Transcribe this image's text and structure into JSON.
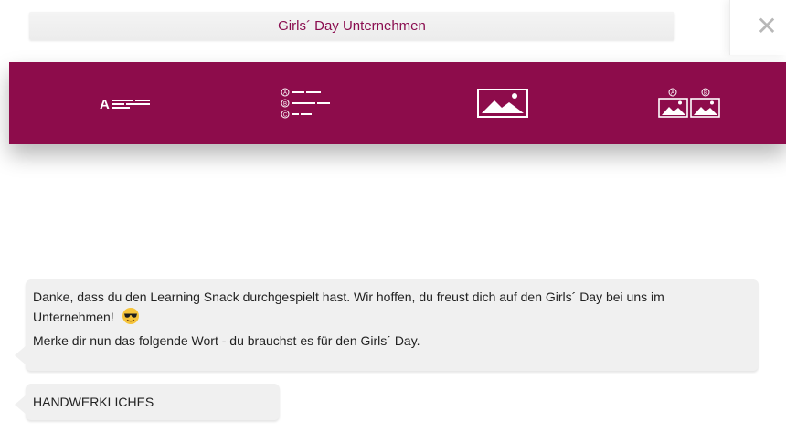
{
  "header": {
    "title": "Girls´ Day Unternehmen",
    "close_symbol": "✕"
  },
  "toolbar": {
    "background": "#8d0c4b",
    "items": [
      {
        "icon": "text-answer-icon",
        "letter": "A"
      },
      {
        "icon": "multiple-choice-icon",
        "options": [
          "A",
          "B",
          "C"
        ]
      },
      {
        "icon": "image-icon"
      },
      {
        "icon": "image-choice-icon",
        "options": [
          "A",
          "B"
        ]
      }
    ]
  },
  "chat": {
    "messages": [
      {
        "line1": "Danke, dass du den Learning Snack durchgespielt hast. Wir hoffen, du freust dich auf den Girls´ Day bei uns im",
        "line2": "Unternehmen!",
        "emoji": "smiling-face-with-sunglasses",
        "line3": "Merke dir nun das folgende Wort - du brauchst es für den Girls´ Day."
      },
      {
        "text": "HANDWERKLICHES"
      }
    ]
  }
}
